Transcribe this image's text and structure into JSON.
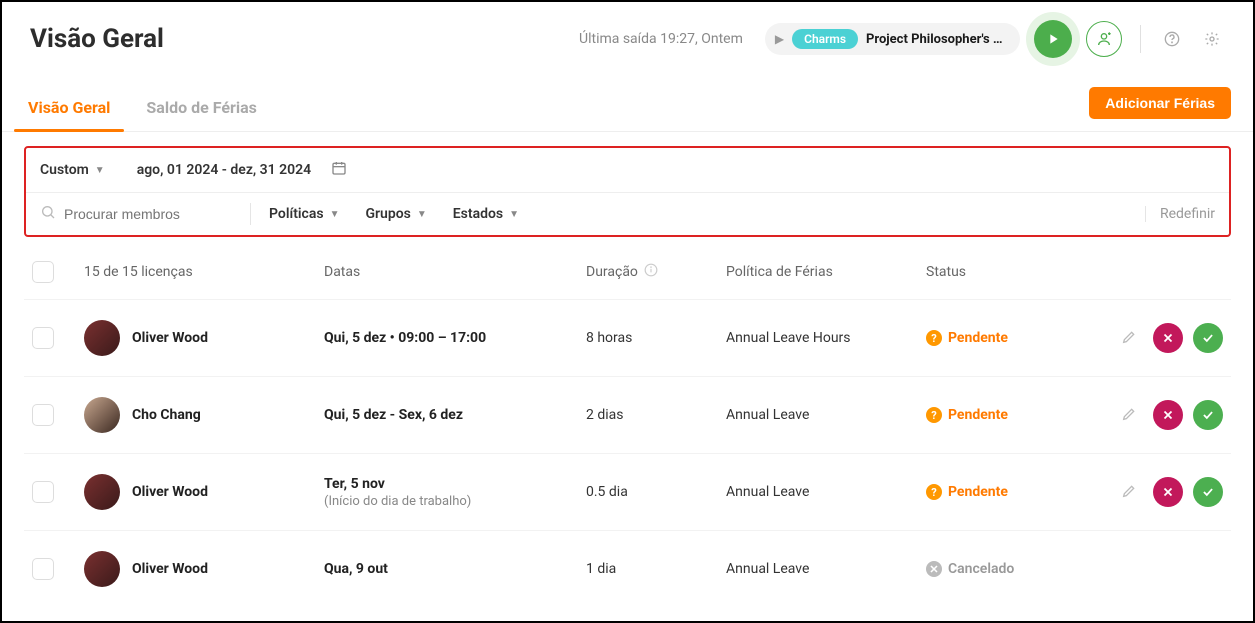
{
  "header": {
    "page_title": "Visão Geral",
    "last_exit": "Última saída 19:27, Ontem",
    "charms_badge": "Charms",
    "project_name": "Project Philosopher's St..."
  },
  "tabs": {
    "overview": "Visão Geral",
    "balance": "Saldo de Férias",
    "add_button": "Adicionar Férias"
  },
  "filters": {
    "custom_label": "Custom",
    "date_range": "ago, 01 2024 - dez, 31 2024",
    "search_placeholder": "Procurar membros",
    "policies": "Políticas",
    "groups": "Grupos",
    "states": "Estados",
    "reset": "Redefinir"
  },
  "table": {
    "count_label": "15 de 15 licenças",
    "col_dates": "Datas",
    "col_duration": "Duração",
    "col_policy": "Política de Férias",
    "col_status": "Status",
    "rows": [
      {
        "name": "Oliver Wood",
        "dates": "Qui, 5 dez • 09:00 – 17:00",
        "dates_sub": "",
        "duration": "8 horas",
        "policy": "Annual Leave Hours",
        "status": "Pendente",
        "status_type": "pending",
        "avatar": "oliver",
        "actions": true
      },
      {
        "name": "Cho Chang",
        "dates": "Qui, 5 dez - Sex, 6 dez",
        "dates_sub": "",
        "duration": "2 dias",
        "policy": "Annual Leave",
        "status": "Pendente",
        "status_type": "pending",
        "avatar": "cho",
        "actions": true
      },
      {
        "name": "Oliver Wood",
        "dates": "Ter, 5 nov",
        "dates_sub": "(Início do dia de trabalho)",
        "duration": "0.5 dia",
        "policy": "Annual Leave",
        "status": "Pendente",
        "status_type": "pending",
        "avatar": "oliver",
        "actions": true
      },
      {
        "name": "Oliver Wood",
        "dates": "Qua, 9 out",
        "dates_sub": "",
        "duration": "1 dia",
        "policy": "Annual Leave",
        "status": "Cancelado",
        "status_type": "cancelled",
        "avatar": "oliver",
        "actions": false
      }
    ]
  }
}
